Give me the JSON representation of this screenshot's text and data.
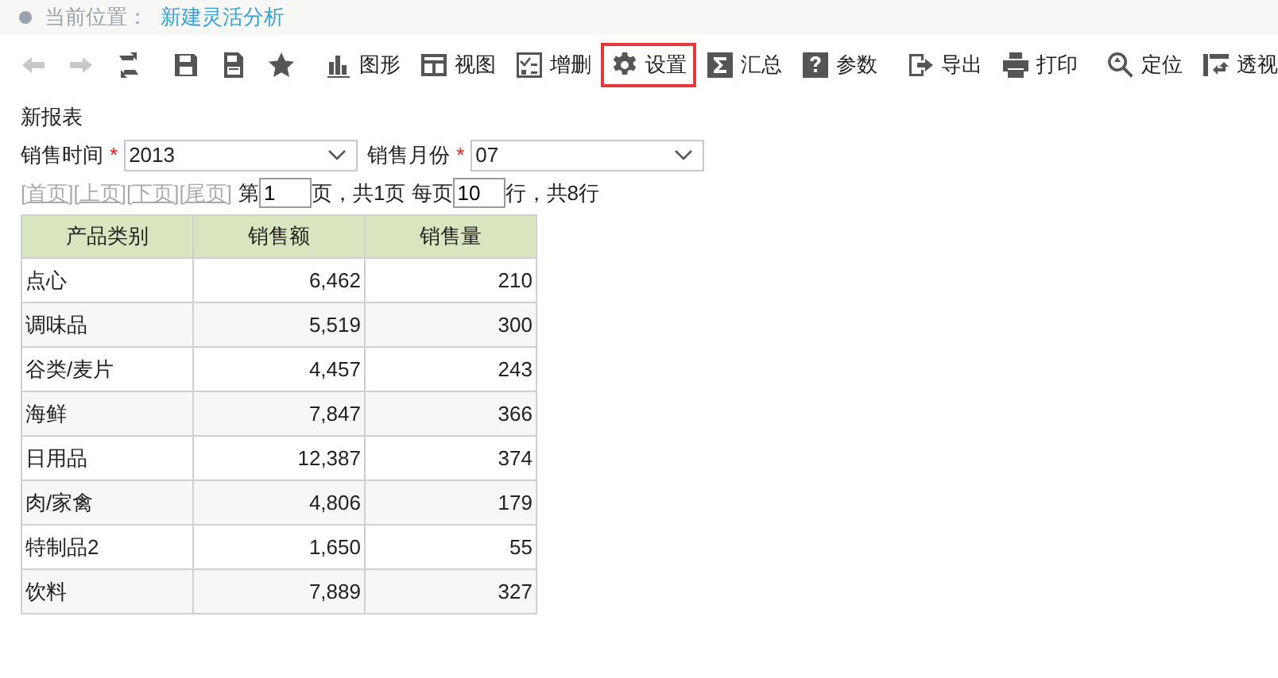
{
  "breadcrumb": {
    "label": "当前位置：",
    "current": "新建灵活分析"
  },
  "toolbar": [
    {
      "kind": "button",
      "disabled": true,
      "highlighted": false
    },
    {
      "kind": "button",
      "disabled": true,
      "highlighted": false
    },
    {
      "kind": "button",
      "disabled": false,
      "highlighted": false
    },
    {
      "kind": "separator"
    },
    {
      "kind": "button",
      "disabled": false,
      "highlighted": false
    },
    {
      "kind": "button",
      "disabled": false,
      "highlighted": false
    },
    {
      "kind": "button",
      "disabled": false,
      "highlighted": false
    },
    {
      "kind": "separator"
    },
    {
      "kind": "button",
      "label": "图形",
      "disabled": false,
      "highlighted": false
    },
    {
      "kind": "button",
      "label": "视图",
      "disabled": false,
      "highlighted": false
    },
    {
      "kind": "button",
      "label": "增删",
      "disabled": false,
      "highlighted": false
    },
    {
      "kind": "button",
      "label": "设置",
      "disabled": false,
      "highlighted": true
    },
    {
      "kind": "button",
      "label": "汇总",
      "disabled": false,
      "highlighted": false
    },
    {
      "kind": "button",
      "label": "参数",
      "disabled": false,
      "highlighted": false
    },
    {
      "kind": "separator"
    },
    {
      "kind": "button",
      "label": "导出",
      "disabled": false,
      "highlighted": false
    },
    {
      "kind": "button",
      "label": "打印",
      "disabled": false,
      "highlighted": false
    },
    {
      "kind": "separator"
    },
    {
      "kind": "button",
      "label": "定位",
      "disabled": false,
      "highlighted": false
    },
    {
      "kind": "button",
      "label": "透视",
      "disabled": false,
      "highlighted": false
    }
  ],
  "report_title": "新报表",
  "filters": [
    {
      "label": "销售时间",
      "required_mark": "*",
      "value": "2013"
    },
    {
      "label": "销售月份",
      "required_mark": "*",
      "value": "07"
    }
  ],
  "pager": {
    "links": [
      {
        "label": "[首页]",
        "disabled": true
      },
      {
        "label": "[上页]",
        "disabled": true
      },
      {
        "label": "[下页]",
        "disabled": true
      },
      {
        "label": "[尾页]",
        "disabled": true
      }
    ],
    "page_prefix": "第",
    "page_value": "1",
    "page_suffix": "页，共1页 每页",
    "rows_value": "10",
    "rows_suffix": "行，共8行"
  },
  "table": {
    "columns": [
      "产品类别",
      "销售额",
      "销售量"
    ],
    "rows": [
      [
        "点心",
        "6,462",
        "210"
      ],
      [
        "调味品",
        "5,519",
        "300"
      ],
      [
        "谷类/麦片",
        "4,457",
        "243"
      ],
      [
        "海鲜",
        "7,847",
        "366"
      ],
      [
        "日用品",
        "12,387",
        "374"
      ],
      [
        "肉/家禽",
        "4,806",
        "179"
      ],
      [
        "特制品2",
        "1,650",
        "55"
      ],
      [
        "饮料",
        "7,889",
        "327"
      ]
    ]
  }
}
